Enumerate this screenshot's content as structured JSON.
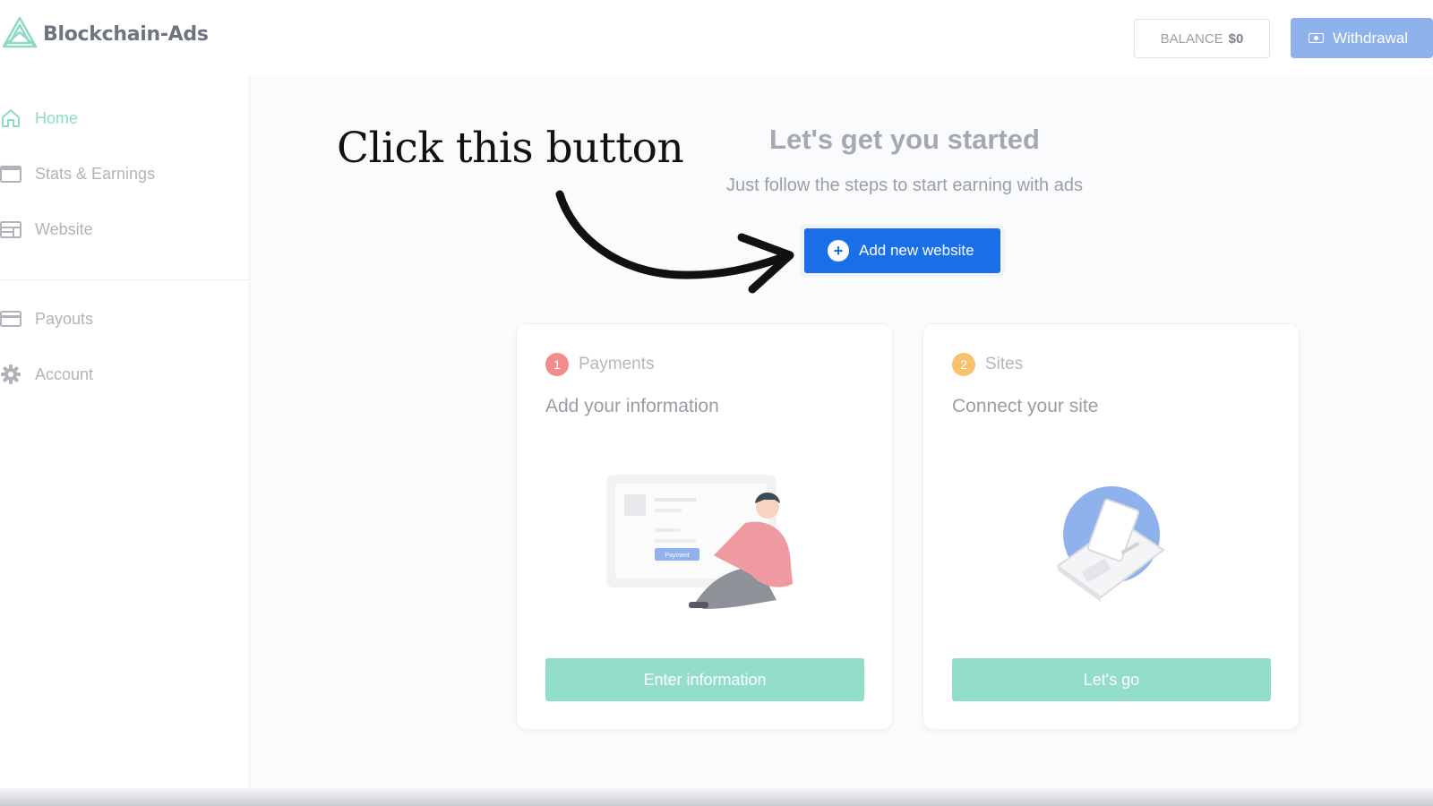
{
  "header": {
    "logo_text": "Blockchain-Ads",
    "balance_label": "BALANCE",
    "balance_value": "$0",
    "withdraw_label": "Withdrawal"
  },
  "sidebar": {
    "items": [
      {
        "label": "Home",
        "icon": "home-icon",
        "active": true
      },
      {
        "label": "Stats & Earnings",
        "icon": "window-icon"
      },
      {
        "label": "Website",
        "icon": "layout-icon"
      },
      {
        "label": "Payouts",
        "icon": "credit-card-icon"
      },
      {
        "label": "Account",
        "icon": "gear-icon"
      }
    ]
  },
  "main": {
    "title": "Let's get you started",
    "subtitle": "Just follow the steps to start earning with ads",
    "add_button_label": "Add new website",
    "cards": [
      {
        "step": "1",
        "step_label": "Payments",
        "title": "Add your information",
        "button": "Enter information",
        "illustration_label": "Payment",
        "step_color": "#f28b8b"
      },
      {
        "step": "2",
        "step_label": "Sites",
        "title": "Connect your site",
        "button": "Let's go",
        "step_color": "#f6c26b"
      }
    ]
  },
  "annotation": {
    "text": "Click this button"
  },
  "colors": {
    "accent_blue": "#1a6fe8",
    "teal": "#93ddcb",
    "withdraw_blue": "#8fb2ec"
  }
}
